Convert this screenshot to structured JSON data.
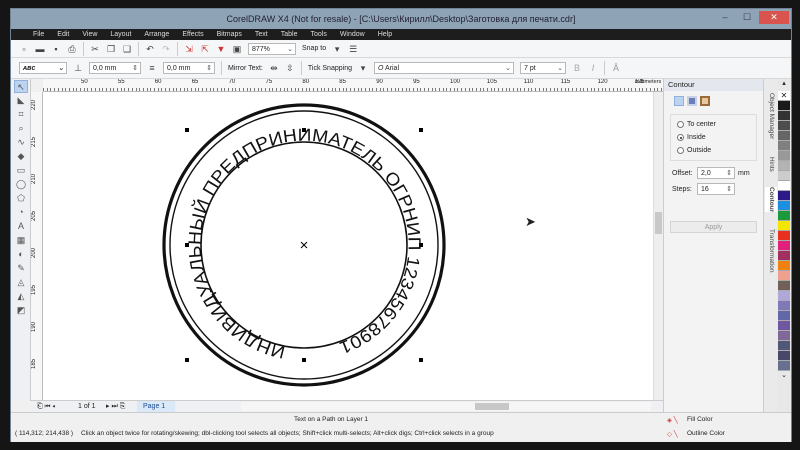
{
  "window": {
    "title": "CorelDRAW X4 (Not for resale) - [C:\\Users\\Кирилл\\Desktop\\Заготовка для печати.cdr]",
    "minimize": "‒",
    "maximize": "☐",
    "close": "✕"
  },
  "menu": [
    "File",
    "Edit",
    "View",
    "Layout",
    "Arrange",
    "Effects",
    "Bitmaps",
    "Text",
    "Table",
    "Tools",
    "Window",
    "Help"
  ],
  "toolbar": {
    "zoom": "877%",
    "snap_to": "Snap to"
  },
  "propbar": {
    "distance_from_path": "0,0 mm",
    "horizontal_offset": "0,0 mm",
    "mirror_text_label": "Mirror Text:",
    "tick_snapping": "Tick Snapping",
    "font": "Arial",
    "font_size": "7 pt",
    "font_glyph": "O"
  },
  "ruler": {
    "units": "millimeters",
    "top_ticks": [
      "50",
      "55",
      "60",
      "65",
      "70",
      "75",
      "80",
      "85",
      "90",
      "95",
      "100",
      "105",
      "110",
      "115",
      "120",
      "125"
    ],
    "left_ticks": [
      "220",
      "215",
      "210",
      "205",
      "200",
      "195",
      "190",
      "185"
    ]
  },
  "stamp": {
    "text": "ИНДИВИДУАЛЬНЫЙ ПРЕДПРИНИМАТЕЛЬ  ОГРНИП 12345678901"
  },
  "docker": {
    "title": "Contour",
    "options": [
      "To center",
      "Inside",
      "Outside"
    ],
    "selected": "Inside",
    "offset_label": "Offset:",
    "offset": "2,0",
    "offset_unit": "mm",
    "steps_label": "Steps:",
    "steps": "16",
    "apply": "Apply"
  },
  "docker_tabs": [
    "Object Manager",
    "Hints",
    "Contour",
    "Transformation"
  ],
  "palette": [
    "#1a1a1a",
    "#333333",
    "#4d4d4d",
    "#666666",
    "#808080",
    "#999999",
    "#b3b3b3",
    "#cccccc",
    "#ffffff",
    "#2b1b8a",
    "#1e8fe0",
    "#1a9a3a",
    "#f5e600",
    "#e83020",
    "#e0207a",
    "#a03060",
    "#f08010",
    "#f0a090",
    "#706058",
    "#b0a8d8",
    "#8078b8",
    "#6068a8",
    "#7058a0",
    "#806898",
    "#505878",
    "#4a4868",
    "#687090"
  ],
  "page_nav": {
    "count": "1 of 1",
    "tab": "Page 1"
  },
  "status": {
    "object": "Text on a Path on Layer 1",
    "coords": "( 114,312; 214,438 )",
    "hint": "Click an object twice for rotating/skewing; dbl-clicking tool selects all objects; Shift+click multi-selects; Alt+click digs; Ctrl+click selects in a group",
    "fill": "Fill Color",
    "outline": "Outline Color"
  }
}
